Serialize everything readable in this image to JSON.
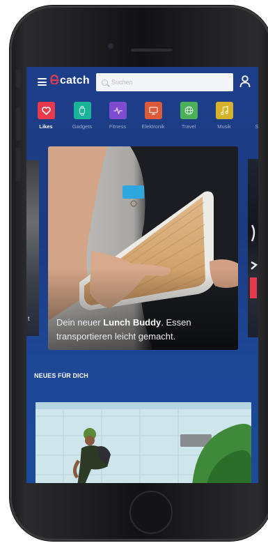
{
  "app": {
    "brand": "catch",
    "brand_color": "#e8394d",
    "header_bg": "#1d3f8a"
  },
  "search": {
    "placeholder": "Suchen"
  },
  "categories": [
    {
      "label": "Likes",
      "icon": "heart-icon",
      "color": "#e8394d",
      "active": true
    },
    {
      "label": "Gadgets",
      "icon": "watch-icon",
      "color": "#19b49a",
      "active": false
    },
    {
      "label": "Fitness",
      "icon": "pulse-icon",
      "color": "#7f4bd1",
      "active": false
    },
    {
      "label": "Elektronik",
      "icon": "monitor-icon",
      "color": "#dc5a3a",
      "active": false
    },
    {
      "label": "Travel",
      "icon": "globe-icon",
      "color": "#4bb05a",
      "active": false
    },
    {
      "label": "Musik",
      "icon": "music-icon",
      "color": "#d6b12c",
      "active": false
    },
    {
      "label": "Sup",
      "icon": "partial-icon",
      "color": "#2d6bd6",
      "active": false
    }
  ],
  "carousel": {
    "left_peek_text": "t",
    "card": {
      "caption_pre": "Dein neuer ",
      "caption_bold": "Lunch Buddy",
      "caption_post": ". Essen transportieren leicht gemacht."
    }
  },
  "section": {
    "title": "NEUES FÜR DICH"
  }
}
